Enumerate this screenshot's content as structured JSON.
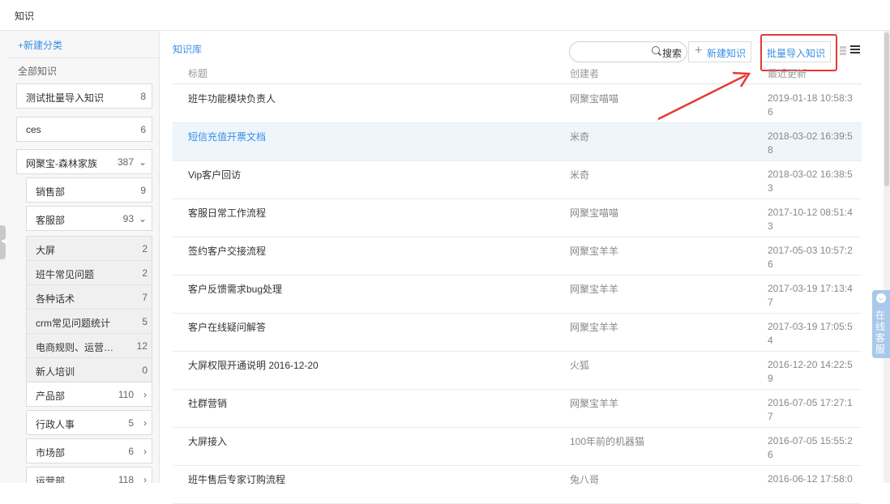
{
  "header": {
    "title": "知识"
  },
  "sidebar": {
    "new_category": "+新建分类",
    "all_knowledge": "全部知识",
    "categories": [
      {
        "label": "测试批量导入知识",
        "count": "8"
      },
      {
        "label": "ces",
        "count": "6"
      },
      {
        "label": "网聚宝-森林家族",
        "count": "387"
      }
    ],
    "sub_categories": [
      {
        "label": "销售部",
        "count": "9"
      },
      {
        "label": "客服部",
        "count": "93"
      }
    ],
    "sub_sub_categories": [
      {
        "label": "大屏",
        "count": "2"
      },
      {
        "label": "班牛常见问题",
        "count": "2"
      },
      {
        "label": "各种话术",
        "count": "7"
      },
      {
        "label": "crm常见问题统计",
        "count": "5"
      },
      {
        "label": "电商规则、运营…",
        "count": "12"
      },
      {
        "label": "新人培训",
        "count": "0"
      }
    ],
    "more_categories": [
      {
        "label": "产品部",
        "count": "110"
      },
      {
        "label": "行政人事",
        "count": "5"
      },
      {
        "label": "市场部",
        "count": "6"
      },
      {
        "label": "运营部",
        "count": "118"
      }
    ]
  },
  "main": {
    "breadcrumb": "知识库",
    "search": {
      "placeholder": "",
      "button": "搜索"
    },
    "new_button": "新建知识",
    "import_button": "批量导入知识",
    "columns": {
      "title": "标题",
      "creator": "创建者",
      "updated": "最近更新"
    },
    "rows": [
      {
        "title": "班牛功能模块负责人",
        "creator": "网聚宝喵喵",
        "updated": "2019-01-18 10:58:36"
      },
      {
        "title": "短信充值开票文档",
        "creator": "米奇",
        "updated": "2018-03-02 16:39:58"
      },
      {
        "title": "Vip客户回访",
        "creator": "米奇",
        "updated": "2018-03-02 16:38:53"
      },
      {
        "title": "客服日常工作流程",
        "creator": "网聚宝喵喵",
        "updated": "2017-10-12 08:51:43"
      },
      {
        "title": "签约客户交接流程",
        "creator": "网聚宝羊羊",
        "updated": "2017-05-03 10:57:26"
      },
      {
        "title": "客户反馈需求bug处理",
        "creator": "网聚宝羊羊",
        "updated": "2017-03-19 17:13:47"
      },
      {
        "title": "客户在线疑问解答",
        "creator": "网聚宝羊羊",
        "updated": "2017-03-19 17:05:54"
      },
      {
        "title": "大屏权限开通说明 2016-12-20",
        "creator": "火狐",
        "updated": "2016-12-20 14:22:59"
      },
      {
        "title": "社群营销",
        "creator": "网聚宝羊羊",
        "updated": "2016-07-05 17:27:17"
      },
      {
        "title": "大屏接入",
        "creator": "100年前的机器猫",
        "updated": "2016-07-05 15:55:26"
      },
      {
        "title": "班牛售后专家订购流程",
        "creator": "兔八哥",
        "updated": "2016-06-12 17:58:0"
      }
    ]
  },
  "online_service": "在线客服",
  "colors": {
    "accent": "#3a8ee6",
    "highlight": "#e53935"
  }
}
